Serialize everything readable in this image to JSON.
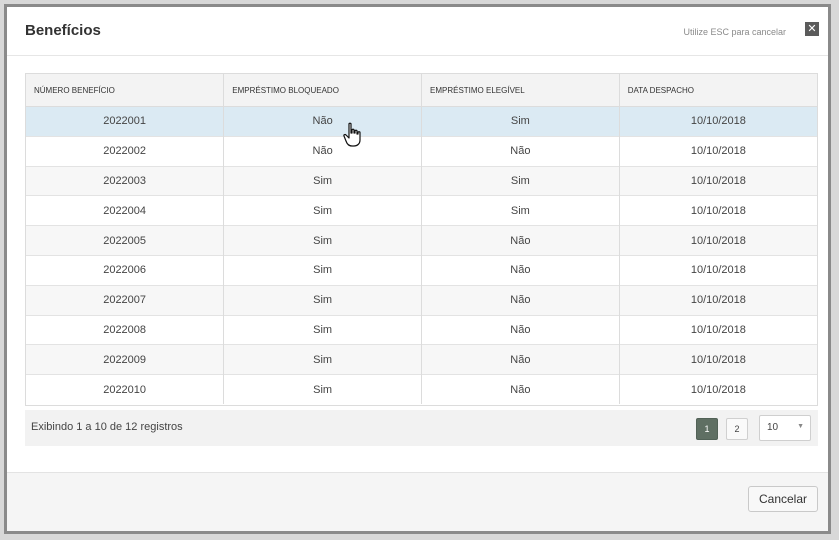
{
  "modal": {
    "title": "Benefícios",
    "esc_hint": "Utilize ESC para cancelar",
    "close_icon": "close-icon"
  },
  "table": {
    "headers": [
      "NÚMERO BENEFÍCIO",
      "EMPRÉSTIMO BLOQUEADO",
      "EMPRÉSTIMO ELEGÍVEL",
      "DATA DESPACHO"
    ],
    "rows": [
      [
        "2022001",
        "Não",
        "Sim",
        "10/10/2018"
      ],
      [
        "2022002",
        "Não",
        "Não",
        "10/10/2018"
      ],
      [
        "2022003",
        "Sim",
        "Sim",
        "10/10/2018"
      ],
      [
        "2022004",
        "Sim",
        "Sim",
        "10/10/2018"
      ],
      [
        "2022005",
        "Sim",
        "Não",
        "10/10/2018"
      ],
      [
        "2022006",
        "Sim",
        "Não",
        "10/10/2018"
      ],
      [
        "2022007",
        "Sim",
        "Não",
        "10/10/2018"
      ],
      [
        "2022008",
        "Sim",
        "Não",
        "10/10/2018"
      ],
      [
        "2022009",
        "Sim",
        "Não",
        "10/10/2018"
      ],
      [
        "2022010",
        "Sim",
        "Não",
        "10/10/2018"
      ]
    ]
  },
  "pagination": {
    "info": "Exibindo 1 a 10 de 12 registros",
    "pages": [
      "1",
      "2"
    ],
    "active_page": "1",
    "page_size": "10"
  },
  "footer": {
    "cancel_label": "Cancelar"
  }
}
